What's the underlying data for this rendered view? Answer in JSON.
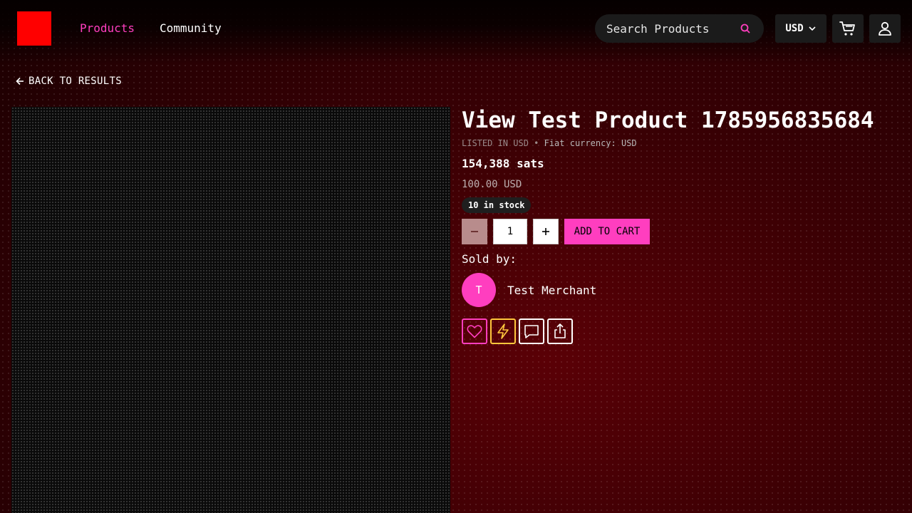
{
  "header": {
    "nav": {
      "products": "Products",
      "community": "Community"
    },
    "search": {
      "placeholder": "Search Products"
    },
    "currency": "USD"
  },
  "back_link": "BACK TO RESULTS",
  "product": {
    "title": "View Test Product 1785956835684",
    "listed_in": "LISTED IN USD",
    "fiat_currency": "Fiat currency: USD",
    "price_sats": "154,388 sats",
    "price_fiat": "100.00 USD",
    "stock": "10 in stock",
    "quantity": "1",
    "add_to_cart": "ADD TO CART",
    "sold_by_label": "Sold by:",
    "merchant": {
      "initial": "T",
      "name": "Test Merchant"
    }
  },
  "colors": {
    "accent": "#ff3ebf",
    "logo": "#ff0000",
    "zap": "#ffc83d",
    "background": "#3a0004"
  },
  "icons": {
    "search": "search-icon",
    "currency_dropdown": "chevron-down-icon",
    "cart": "cart-icon",
    "account": "user-icon",
    "back": "arrow-left-icon",
    "minus": "minus-icon",
    "plus": "plus-icon",
    "favorite": "heart-icon",
    "zap": "lightning-icon",
    "message": "chat-icon",
    "share": "share-icon"
  }
}
